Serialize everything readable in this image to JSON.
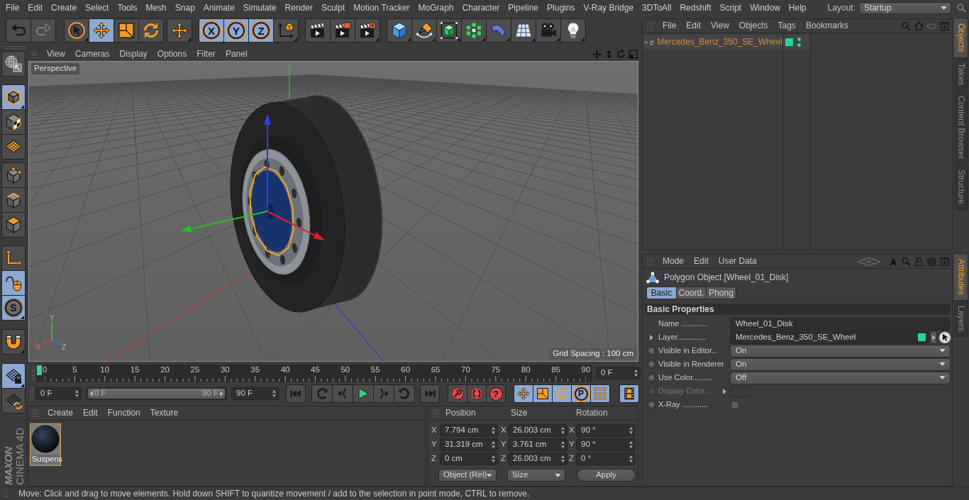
{
  "menu_bar": {
    "items": [
      "File",
      "Edit",
      "Create",
      "Select",
      "Tools",
      "Mesh",
      "Snap",
      "Animate",
      "Simulate",
      "Render",
      "Sculpt",
      "Motion Tracker",
      "MoGraph",
      "Character",
      "Pipeline",
      "Plugins",
      "V-Ray Bridge",
      "3DToAll",
      "Redshift",
      "Script",
      "Window",
      "Help"
    ],
    "layout_label": "Layout:",
    "layout_value": "Startup"
  },
  "toolbar": {
    "groups": [
      {
        "buttons": [
          {
            "selected": false,
            "disabled": false
          },
          {
            "selected": false,
            "disabled": true
          }
        ]
      },
      {
        "buttons": [
          {
            "selected": false
          },
          {
            "selected": true
          },
          {
            "selected": false
          },
          {
            "selected": false
          }
        ]
      },
      {
        "buttons": [
          {
            "selected": false
          }
        ]
      },
      {
        "buttons": [
          {
            "label": "X",
            "selected": true
          },
          {
            "label": "Y",
            "selected": true
          },
          {
            "label": "Z",
            "selected": true
          },
          {
            "selected": false
          }
        ]
      },
      {
        "buttons": [
          {
            "selected": false
          },
          {
            "selected": false
          },
          {
            "selected": false
          }
        ]
      },
      {
        "buttons": [
          {
            "selected": false
          },
          {
            "selected": false
          },
          {
            "selected": false
          },
          {
            "selected": false
          },
          {
            "selected": false
          },
          {
            "selected": false
          },
          {
            "selected": false
          },
          {
            "selected": false
          }
        ]
      }
    ]
  },
  "left_toolbar": {
    "groups": [
      {
        "buttons": [
          {
            "selected": false
          }
        ]
      },
      {
        "buttons": [
          {
            "selected": true
          },
          {
            "selected": false
          },
          {
            "selected": false
          }
        ]
      },
      {
        "buttons": [
          {
            "selected": false
          },
          {
            "selected": false
          },
          {
            "selected": false
          }
        ]
      },
      {
        "buttons": [
          {
            "selected": false
          },
          {
            "selected": true
          },
          {
            "label": "S",
            "selected": true
          }
        ]
      },
      {
        "buttons": [
          {
            "selected": false
          }
        ]
      },
      {
        "buttons": [
          {
            "selected": true
          },
          {
            "selected": false
          }
        ]
      }
    ]
  },
  "logo": {
    "brand": "MAXON",
    "product": "CINEMA 4D"
  },
  "viewport": {
    "menu": [
      "View",
      "Cameras",
      "Display",
      "Options",
      "Filter",
      "Panel"
    ],
    "camera": "Perspective",
    "grid_spacing": "Grid Spacing : 100 cm",
    "axis_labels": [
      "Y",
      "X",
      "Z"
    ]
  },
  "timeline": {
    "ticks": [
      "0",
      "5",
      "10",
      "15",
      "20",
      "25",
      "30",
      "35",
      "40",
      "45",
      "50",
      "55",
      "60",
      "65",
      "70",
      "75",
      "80",
      "85",
      "90"
    ],
    "playhead": {
      "level": 0
    },
    "current_frame": "0 F"
  },
  "playback": {
    "start_frame": "0 F",
    "range_slider": {
      "start": "0 F",
      "end": "90 F",
      "level": 1
    },
    "end_frame": "90 F",
    "groups": [
      {
        "buttons": [
          {
            "selected": false
          }
        ]
      },
      {
        "buttons": [
          {
            "selected": false
          },
          {
            "selected": false
          },
          {
            "selected": false
          },
          {
            "selected": false
          },
          {
            "selected": false
          }
        ]
      },
      {
        "buttons": [
          {
            "selected": false
          }
        ]
      },
      {
        "buttons": [
          {
            "selected": false
          },
          {
            "selected": false
          },
          {
            "label": "?",
            "selected": false
          }
        ]
      },
      {
        "buttons": [
          {
            "selected": true
          },
          {
            "selected": true
          },
          {
            "selected": true
          },
          {
            "label": "P",
            "selected": true
          },
          {
            "selected": true
          }
        ]
      },
      {
        "buttons": [
          {
            "selected": true
          }
        ]
      }
    ]
  },
  "materials": {
    "menu": [
      "Create",
      "Edit",
      "Function",
      "Texture"
    ],
    "items": [
      {
        "name": "Suspens",
        "selected": true
      }
    ]
  },
  "coordinates": {
    "headers": [
      "Position",
      "Size",
      "Rotation"
    ],
    "rows": [
      {
        "cells": [
          {
            "axis": "X",
            "value": "7.794 cm"
          },
          {
            "axis": "X",
            "value": "26.003 cm"
          },
          {
            "axis": "X",
            "value": "90 °"
          }
        ]
      },
      {
        "cells": [
          {
            "axis": "Y",
            "value": "31.319 cm"
          },
          {
            "axis": "Y",
            "value": "3.761 cm"
          },
          {
            "axis": "Y",
            "value": "90 °"
          }
        ]
      },
      {
        "cells": [
          {
            "axis": "Z",
            "value": "0 cm"
          },
          {
            "axis": "Z",
            "value": "26.003 cm"
          },
          {
            "axis": "Z",
            "value": "0 °"
          }
        ]
      }
    ],
    "mode": "Object (Rel)",
    "size_mode": "Size",
    "apply": "Apply"
  },
  "objects": {
    "menu": [
      "File",
      "Edit",
      "View",
      "Objects",
      "Tags",
      "Bookmarks"
    ],
    "items": [
      {
        "name": "Mercedes_Benz_350_SE_Wheel",
        "expanded": false,
        "color": "#2ad59a"
      }
    ]
  },
  "attributes": {
    "menu": [
      "Mode",
      "Edit",
      "User Data"
    ],
    "title": "Polygon Object [Wheel_01_Disk]",
    "tabs": [
      {
        "label": "Basic",
        "selected": true
      },
      {
        "label": "Coord.",
        "selected": false
      },
      {
        "label": "Phong",
        "selected": false
      }
    ],
    "section": "Basic Properties",
    "fields": [
      {
        "kind": "text",
        "label": "Name ............",
        "value": "Wheel_01_Disk",
        "disabled": false
      },
      {
        "kind": "layer",
        "label": "Layer.............",
        "value": "Mercedes_Benz_350_SE_Wheel",
        "color": "#2ad59a",
        "disabled": false
      },
      {
        "kind": "dropdown",
        "label": "Visible in Editor...",
        "value": "On",
        "disabled": false
      },
      {
        "kind": "dropdown",
        "label": "Visible in Renderer",
        "value": "On",
        "disabled": false
      },
      {
        "kind": "dropdown",
        "label": "Use Color.........",
        "value": "Off",
        "disabled": false
      },
      {
        "kind": "color",
        "label": "Display Color...",
        "disabled": true
      },
      {
        "kind": "checkbox",
        "label": "X-Ray ............",
        "checked": false,
        "disabled": false
      }
    ]
  },
  "side_tabs": {
    "upper": [
      {
        "label": "Objects",
        "selected": true
      },
      {
        "label": "Takes",
        "selected": false
      },
      {
        "label": "Content Browser",
        "selected": false
      },
      {
        "label": "Structure",
        "selected": false
      }
    ],
    "lower": [
      {
        "label": "Attributes",
        "selected": true
      },
      {
        "label": "Layers",
        "selected": false
      }
    ]
  },
  "status_bar": {
    "text": "Move: Click and drag to move elements. Hold down SHIFT to quantize movement / add to the selection in point mode, CTRL to remove."
  }
}
